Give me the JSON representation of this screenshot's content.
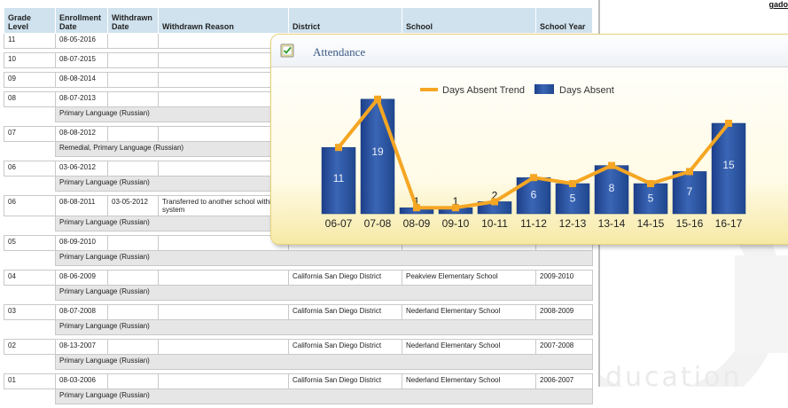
{
  "top_right_link": "gado",
  "table": {
    "headers": [
      "Grade Level",
      "Enrollment Date",
      "Withdrawn Date",
      "Withdrawn Reason",
      "District",
      "School",
      "School Year"
    ],
    "rows": [
      {
        "grade": "11",
        "enroll": "08-05-2016",
        "withdrawn": "",
        "reason": "",
        "district": "",
        "school": "",
        "year": "",
        "note": ""
      },
      {
        "grade": "10",
        "enroll": "08-07-2015",
        "withdrawn": "",
        "reason": "",
        "district": "",
        "school": "",
        "year": "",
        "note": ""
      },
      {
        "grade": "09",
        "enroll": "08-08-2014",
        "withdrawn": "",
        "reason": "",
        "district": "",
        "school": "",
        "year": "",
        "note": ""
      },
      {
        "grade": "08",
        "enroll": "08-07-2013",
        "withdrawn": "",
        "reason": "",
        "district": "",
        "school": "",
        "year": "",
        "note": "Primary Language (Russian)"
      },
      {
        "grade": "07",
        "enroll": "08-08-2012",
        "withdrawn": "",
        "reason": "",
        "district": "",
        "school": "",
        "year": "",
        "note": "Remedial, Primary Language (Russian)"
      },
      {
        "grade": "06",
        "enroll": "03-06-2012",
        "withdrawn": "",
        "reason": "",
        "district": "",
        "school": "",
        "year": "",
        "note": "Primary Language (Russian)"
      },
      {
        "grade": "06",
        "enroll": "08-08-2011",
        "withdrawn": "03-05-2012",
        "reason": "Transferred to another school within system",
        "district": "",
        "school": "",
        "year": "",
        "note": "Primary Language (Russian)"
      },
      {
        "grade": "05",
        "enroll": "08-09-2010",
        "withdrawn": "",
        "reason": "",
        "district": "",
        "school": "",
        "year": "",
        "note": "Primary Language (Russian)"
      },
      {
        "grade": "04",
        "enroll": "08-06-2009",
        "withdrawn": "",
        "reason": "",
        "district": "California San Diego District",
        "school": "Peakview Elementary School",
        "year": "2009-2010",
        "note": "Primary Language (Russian)"
      },
      {
        "grade": "03",
        "enroll": "08-07-2008",
        "withdrawn": "",
        "reason": "",
        "district": "California San Diego District",
        "school": "Nederland Elementary School",
        "year": "2008-2009",
        "note": "Primary Language (Russian)"
      },
      {
        "grade": "02",
        "enroll": "08-13-2007",
        "withdrawn": "",
        "reason": "",
        "district": "California San Diego District",
        "school": "Nederland Elementary School",
        "year": "2007-2008",
        "note": "Primary Language (Russian)"
      },
      {
        "grade": "01",
        "enroll": "08-03-2006",
        "withdrawn": "",
        "reason": "",
        "district": "California San Diego District",
        "school": "Nederland Elementary School",
        "year": "2006-2007",
        "note": "Primary Language (Russian)"
      }
    ]
  },
  "watermark_text": "ducation",
  "attendance_panel": {
    "title": "Attendance",
    "icon": "clipboard-check-icon"
  },
  "colors": {
    "bar": "#3a66b5",
    "trend": "#f5a623",
    "header_bg": "#cfe2ee"
  },
  "chart_data": {
    "type": "bar",
    "categories": [
      "06-07",
      "07-08",
      "08-09",
      "09-10",
      "10-11",
      "11-12",
      "12-13",
      "13-14",
      "14-15",
      "15-16",
      "16-17"
    ],
    "series": [
      {
        "name": "Days Absent Trend",
        "type": "line",
        "values": [
          11,
          19,
          1,
          1,
          2,
          6,
          5,
          8,
          5,
          7,
          15
        ]
      },
      {
        "name": "Days Absent",
        "type": "bar",
        "values": [
          11,
          19,
          1,
          1,
          2,
          6,
          5,
          8,
          5,
          7,
          15
        ]
      }
    ],
    "ylim": [
      0,
      20
    ],
    "legend": "top",
    "grid": false
  }
}
